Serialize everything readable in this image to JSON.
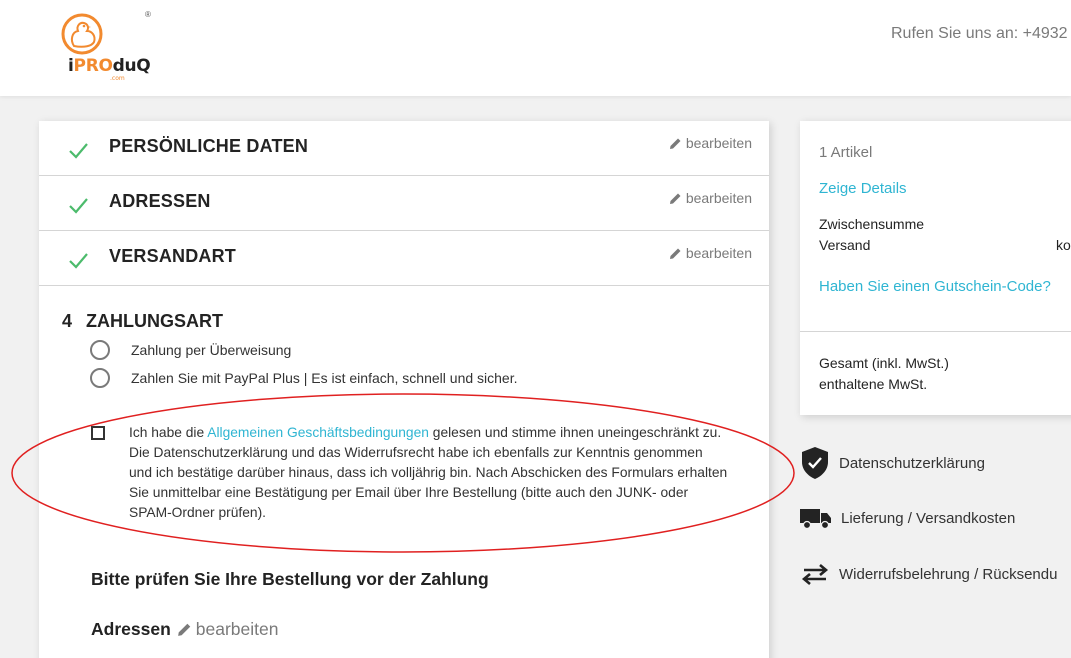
{
  "header": {
    "logo": {
      "i": "i",
      "pro": "PRO",
      "duq": "duQ",
      "com": ".com",
      "reg": "®"
    },
    "phone": "Rufen Sie uns an: +4932"
  },
  "checkout": {
    "steps": [
      {
        "title": "PERSÖNLICHE DATEN",
        "edit": "bearbeiten",
        "status": "done"
      },
      {
        "title": "ADRESSEN",
        "edit": "bearbeiten",
        "status": "done"
      },
      {
        "title": "VERSANDART",
        "edit": "bearbeiten",
        "status": "done"
      }
    ],
    "payment": {
      "number": "4",
      "title": "ZAHLUNGSART",
      "options": [
        "Zahlung per Überweisung",
        "Zahlen Sie mit PayPal Plus | Es ist einfach, schnell und sicher."
      ],
      "terms_before": "Ich habe die ",
      "terms_link": "Allgemeinen Geschäftsbedingungen",
      "terms_after": " gelesen und stimme ihnen uneingeschränkt zu. Die Datenschutzerklärung und das Widerrufsrecht habe ich ebenfalls zur Kenntnis genommen und ich bestätige darüber hinaus, dass ich volljährig bin. Nach Abschicken des Formulars erhalten Sie unmittelbar eine Bestätigung per Email über Ihre Bestellung (bitte auch den JUNK- oder SPAM-Ordner prüfen)."
    },
    "review_heading": "Bitte prüfen Sie Ihre Bestellung vor der Zahlung",
    "addresses_heading": "Adressen",
    "addresses_edit": "bearbeiten"
  },
  "summary": {
    "items": "1 Artikel",
    "show_details": "Zeige Details",
    "subtotal_label": "Zwischensumme",
    "shipping_label": "Versand",
    "shipping_value": "ko",
    "voucher": "Haben Sie einen Gutschein-Code?",
    "total_label": "Gesamt (inkl. MwSt.)",
    "tax_label": "enthaltene MwSt."
  },
  "reassurance": [
    {
      "label": "Datenschutzerklärung",
      "icon": "shield-check-icon"
    },
    {
      "label": "Lieferung / Versandkosten",
      "icon": "truck-icon"
    },
    {
      "label": "Widerrufsbelehrung / Rücksendu",
      "icon": "swap-arrows-icon"
    }
  ],
  "colors": {
    "accent": "#2fb5d2",
    "check": "#4cbb6c",
    "brand": "#f28a2f",
    "annotation": "#e02020"
  }
}
